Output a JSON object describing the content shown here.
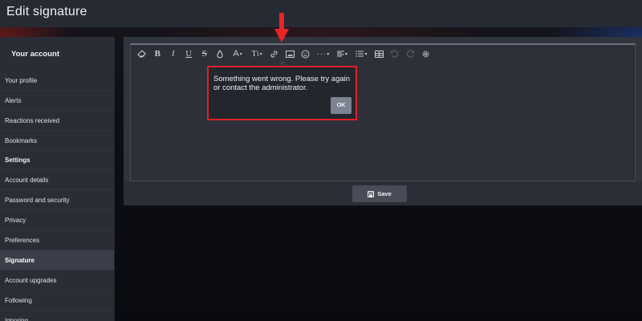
{
  "header": {
    "title": "Edit signature"
  },
  "sidebar": {
    "header": "Your account",
    "items": [
      {
        "label": "Your profile",
        "type": "item"
      },
      {
        "label": "Alerts",
        "type": "item"
      },
      {
        "label": "Reactions received",
        "type": "item"
      },
      {
        "label": "Bookmarks",
        "type": "item"
      },
      {
        "label": "Settings",
        "type": "section"
      },
      {
        "label": "Account details",
        "type": "item"
      },
      {
        "label": "Password and security",
        "type": "item"
      },
      {
        "label": "Privacy",
        "type": "item"
      },
      {
        "label": "Preferences",
        "type": "item"
      },
      {
        "label": "Signature",
        "type": "item",
        "active": true
      },
      {
        "label": "Account upgrades",
        "type": "item"
      },
      {
        "label": "Following",
        "type": "item"
      },
      {
        "label": "Ignoring",
        "type": "item"
      }
    ]
  },
  "toolbar": {
    "buttons": [
      "eraser-icon",
      "bold-icon",
      "italic-icon",
      "underline-icon",
      "strikethrough-icon",
      "text-color-icon",
      "font-color-icon",
      "font-size-icon",
      "link-icon",
      "image-icon",
      "smile-icon",
      "more-icon",
      "align-icon",
      "list-icon",
      "table-icon",
      "undo-icon",
      "redo-icon",
      "settings-icon"
    ]
  },
  "editor": {
    "value": ""
  },
  "error_popup": {
    "message": "Something went wrong. Please try again or contact the administrator.",
    "ok_label": "OK"
  },
  "footer": {
    "save_label": "Save"
  },
  "colors": {
    "highlight": "#e0202a",
    "arrow": "#e8232a"
  }
}
